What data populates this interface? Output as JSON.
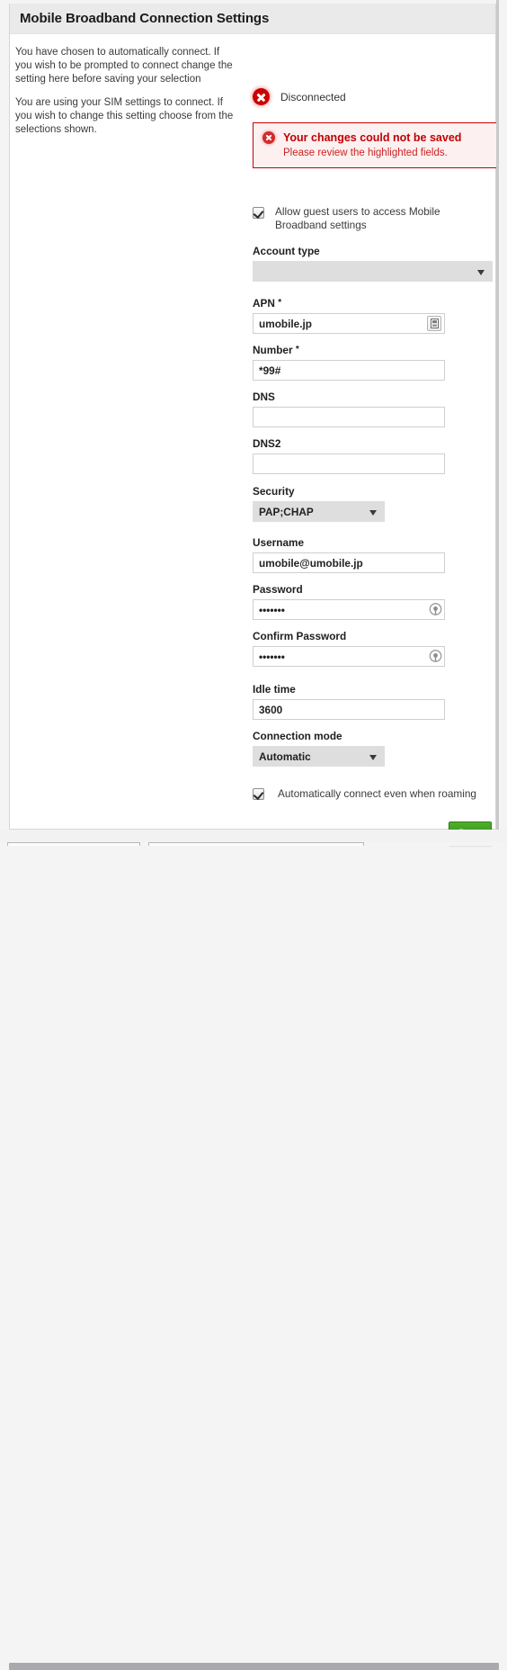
{
  "window": {
    "title": "Mobile Broadband Connection Settings"
  },
  "description": {
    "paragraph1": "You have chosen to automatically connect. If you wish to be prompted to connect change the setting here before saving your selection",
    "paragraph2": "You are using your SIM settings to connect. If you wish to change this setting choose from the selections shown."
  },
  "status": {
    "label": "Disconnected",
    "icon": "error-circle-x-icon",
    "color": "#cc0000"
  },
  "error_banner": {
    "icon": "error-circle-x-icon",
    "title": "Your changes could not be saved",
    "subtitle": "Please review the highlighted fields.",
    "border_color": "#cc0000",
    "background_color": "#fdf0f0",
    "text_color": "#c00000"
  },
  "guest_access": {
    "checked": true,
    "label": "Allow guest users to access Mobile Broadband settings"
  },
  "fields": {
    "account_type": {
      "label": "Account type",
      "value": "",
      "options": [
        ""
      ],
      "control": "select",
      "disabled": true
    },
    "apn": {
      "label": "APN",
      "required_marker": "*",
      "value": "umobile.jp",
      "placeholder": "",
      "control": "text",
      "trailing_icon": "sim-card-icon"
    },
    "number": {
      "label": "Number",
      "required_marker": "*",
      "value": "*99#",
      "placeholder": "",
      "control": "text"
    },
    "dns": {
      "label": "DNS",
      "value": "",
      "placeholder": "",
      "control": "text"
    },
    "dns2": {
      "label": "DNS2",
      "value": "",
      "placeholder": "",
      "control": "text"
    },
    "security": {
      "label": "Security",
      "value": "PAP;CHAP",
      "options": [
        "PAP;CHAP"
      ],
      "control": "select"
    },
    "username": {
      "label": "Username",
      "value": "umobile@umobile.jp",
      "placeholder": "",
      "control": "text"
    },
    "password": {
      "label": "Password",
      "value": "•••••••",
      "placeholder": "",
      "control": "password",
      "trailing_icon": "reveal-password-icon"
    },
    "confirm_password": {
      "label": "Confirm Password",
      "value": "•••••••",
      "placeholder": "",
      "control": "password",
      "trailing_icon": "reveal-password-icon"
    },
    "idle_time": {
      "label": "Idle time",
      "value": "3600",
      "placeholder": "",
      "control": "text"
    },
    "connection_mode": {
      "label": "Connection mode",
      "value": "Automatic",
      "options": [
        "Automatic"
      ],
      "control": "select"
    }
  },
  "roaming": {
    "checked": true,
    "label": "Automatically connect even when roaming"
  },
  "actions": {
    "save_label": "Save",
    "save_color": "#3f9d22"
  }
}
